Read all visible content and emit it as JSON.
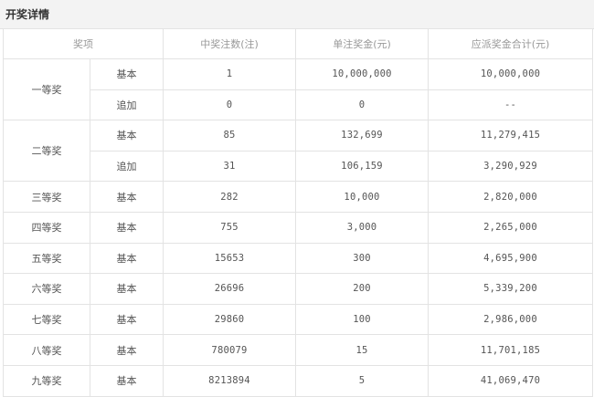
{
  "panel": {
    "title": "开奖详情"
  },
  "table": {
    "headers": [
      "奖项",
      "中奖注数(注)",
      "单注奖金(元)",
      "应派奖金合计(元)"
    ],
    "rows": [
      {
        "grade": "一等奖",
        "type": "基本",
        "count": "1",
        "prize": "10,000,000",
        "total": "10,000,000"
      },
      {
        "grade": "",
        "type": "追加",
        "count": "0",
        "prize": "0",
        "total": "--"
      },
      {
        "grade": "二等奖",
        "type": "基本",
        "count": "85",
        "prize": "132,699",
        "total": "11,279,415"
      },
      {
        "grade": "",
        "type": "追加",
        "count": "31",
        "prize": "106,159",
        "total": "3,290,929"
      },
      {
        "grade": "三等奖",
        "type": "基本",
        "count": "282",
        "prize": "10,000",
        "total": "2,820,000"
      },
      {
        "grade": "四等奖",
        "type": "基本",
        "count": "755",
        "prize": "3,000",
        "total": "2,265,000"
      },
      {
        "grade": "五等奖",
        "type": "基本",
        "count": "15653",
        "prize": "300",
        "total": "4,695,900"
      },
      {
        "grade": "六等奖",
        "type": "基本",
        "count": "26696",
        "prize": "200",
        "total": "5,339,200"
      },
      {
        "grade": "七等奖",
        "type": "基本",
        "count": "29860",
        "prize": "100",
        "total": "2,986,000"
      },
      {
        "grade": "八等奖",
        "type": "基本",
        "count": "780079",
        "prize": "15",
        "total": "11,701,185"
      },
      {
        "grade": "九等奖",
        "type": "基本",
        "count": "8213894",
        "prize": "5",
        "total": "41,069,470"
      }
    ]
  }
}
